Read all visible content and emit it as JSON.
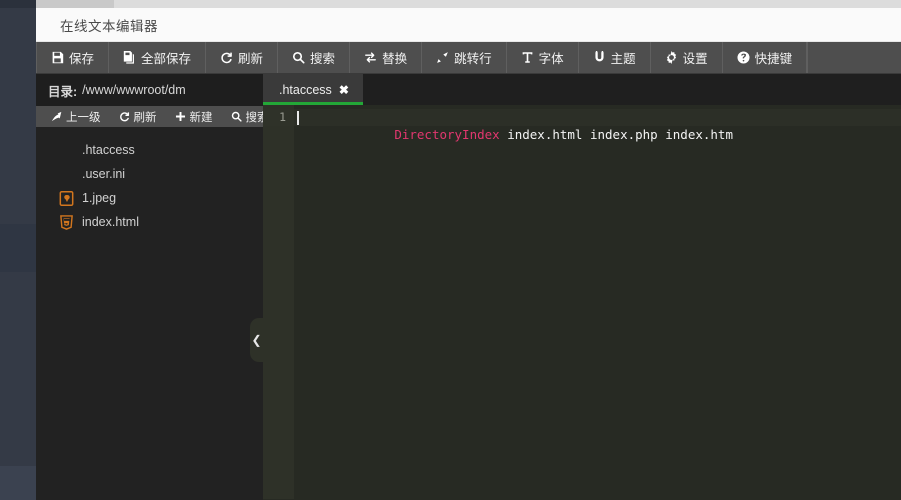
{
  "window": {
    "title": "在线文本编辑器"
  },
  "toolbar": {
    "items": [
      {
        "label": "保存",
        "icon": "save-icon"
      },
      {
        "label": "全部保存",
        "icon": "save-all-icon"
      },
      {
        "label": "刷新",
        "icon": "refresh-icon"
      },
      {
        "label": "搜索",
        "icon": "search-icon"
      },
      {
        "label": "替换",
        "icon": "replace-icon"
      },
      {
        "label": "跳转行",
        "icon": "goto-line-icon"
      },
      {
        "label": "字体",
        "icon": "font-icon"
      },
      {
        "label": "主题",
        "icon": "theme-icon"
      },
      {
        "label": "设置",
        "icon": "gear-icon"
      },
      {
        "label": "快捷键",
        "icon": "help-icon"
      }
    ]
  },
  "sidebar": {
    "directory_label": "目录:",
    "directory_path": "/www/wwwroot/dm",
    "tools": [
      {
        "label": "上一级",
        "icon": "up-level-icon"
      },
      {
        "label": "刷新",
        "icon": "refresh-icon"
      },
      {
        "label": "新建",
        "icon": "plus-icon"
      },
      {
        "label": "搜索",
        "icon": "search-icon"
      }
    ],
    "files": [
      {
        "name": ".htaccess",
        "icon": "none"
      },
      {
        "name": ".user.ini",
        "icon": "none"
      },
      {
        "name": "1.jpeg",
        "icon": "image-file-icon"
      },
      {
        "name": "index.html",
        "icon": "html5-icon"
      }
    ],
    "collapse_icon": "chevron-left-icon"
  },
  "editor": {
    "tab": {
      "label": ".htaccess",
      "close_icon": "close-icon",
      "active_accent": "#23a737"
    },
    "gutter": [
      "1"
    ],
    "lines": [
      {
        "tokens": [
          {
            "text": "DirectoryIndex",
            "type": "keyword"
          },
          {
            "text": " index.html index.php index.htm",
            "type": "plain"
          }
        ]
      }
    ],
    "keyword_color": "#e2376f",
    "text_color": "#f4f4f4",
    "background": "#272a23"
  }
}
